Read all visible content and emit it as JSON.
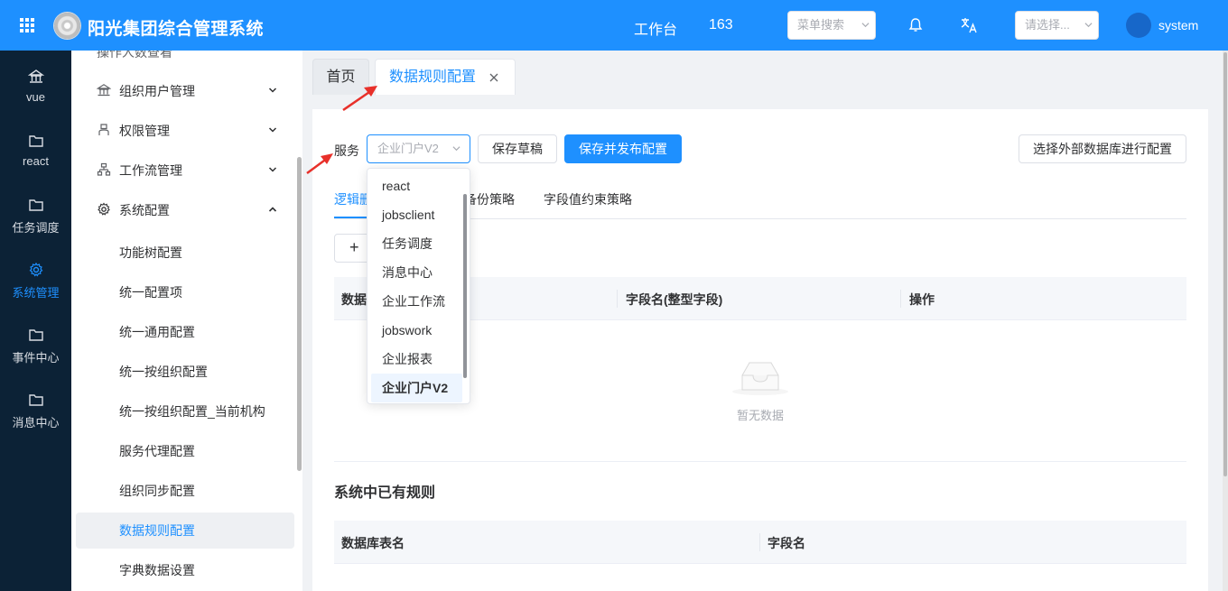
{
  "header": {
    "app_title": "阳光集团综合管理系统",
    "workbench": "工作台",
    "count": "163",
    "menu_search_placeholder": "菜单搜索",
    "select_placeholder": "请选择...",
    "username": "system"
  },
  "rail": {
    "items": [
      {
        "label": "vue",
        "icon": "bank-icon"
      },
      {
        "label": "react",
        "icon": "folder-icon"
      },
      {
        "label": "任务调度",
        "icon": "folder-icon"
      },
      {
        "label": "系统管理",
        "icon": "gear-icon",
        "active": true
      },
      {
        "label": "事件中心",
        "icon": "folder-icon"
      },
      {
        "label": "消息中心",
        "icon": "folder-icon"
      }
    ]
  },
  "sidebar": {
    "cut_item": "操作人数查看",
    "groups": [
      {
        "label": "组织用户管理",
        "icon": "bank-icon",
        "expanded": false
      },
      {
        "label": "权限管理",
        "icon": "user-icon",
        "expanded": false
      },
      {
        "label": "工作流管理",
        "icon": "flow-icon",
        "expanded": false
      },
      {
        "label": "系统配置",
        "icon": "gear-icon",
        "expanded": true
      }
    ],
    "sub_items": [
      {
        "label": "功能树配置"
      },
      {
        "label": "统一配置项"
      },
      {
        "label": "统一通用配置"
      },
      {
        "label": "统一按组织配置"
      },
      {
        "label": "统一按组织配置_当前机构"
      },
      {
        "label": "服务代理配置"
      },
      {
        "label": "组织同步配置"
      },
      {
        "label": "数据规则配置",
        "active": true
      },
      {
        "label": "字典数据设置"
      }
    ]
  },
  "tabs": {
    "home": "首页",
    "current": "数据规则配置"
  },
  "toolbar": {
    "service_label": "服务",
    "service_value": "企业门户V2",
    "save_draft": "保存草稿",
    "save_publish": "保存并发布配置",
    "external_db": "选择外部数据库进行配置"
  },
  "sub_tabs": {
    "items": [
      "逻辑删",
      "备份策略",
      "字段值约束策略"
    ],
    "hidden_tail": "逻辑删除策略"
  },
  "table1": {
    "col1": "数据",
    "col2": "字段名(整型字段)",
    "col3": "操作",
    "empty_text": "暂无数据"
  },
  "section2": {
    "title": "系统中已有规则",
    "col1": "数据库表名",
    "col2": "字段名"
  },
  "dropdown": {
    "options": [
      "react",
      "jobsclient",
      "任务调度",
      "消息中心",
      "企业工作流",
      "jobswork",
      "企业报表",
      "企业门户V2"
    ],
    "selected": "企业门户V2"
  },
  "colors": {
    "primary": "#1e90ff",
    "rail_bg": "#0c2236",
    "annotation_red": "#e8302a"
  }
}
